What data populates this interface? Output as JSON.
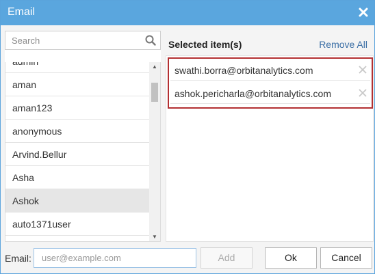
{
  "dialog": {
    "title": "Email",
    "close_icon": "close-x-icon"
  },
  "search": {
    "placeholder": "Search",
    "icon": "search-icon"
  },
  "users": [
    "admin",
    "aman",
    "aman123",
    "anonymous",
    "Arvind.Bellur",
    "Asha",
    "Ashok",
    "auto1371user"
  ],
  "highlighted_user": "Ashok",
  "selected": {
    "heading": "Selected item(s)",
    "remove_all": "Remove All",
    "items": [
      "swathi.borra@orbitanalytics.com",
      "ashok.pericharla@orbitanalytics.com"
    ]
  },
  "footer": {
    "email_label": "Email:",
    "email_placeholder": "user@example.com",
    "add_label": "Add",
    "ok_label": "Ok",
    "cancel_label": "Cancel"
  },
  "colors": {
    "titlebar": "#5aa6de",
    "highlight_box": "#b32f31",
    "link": "#3a6ea5"
  }
}
